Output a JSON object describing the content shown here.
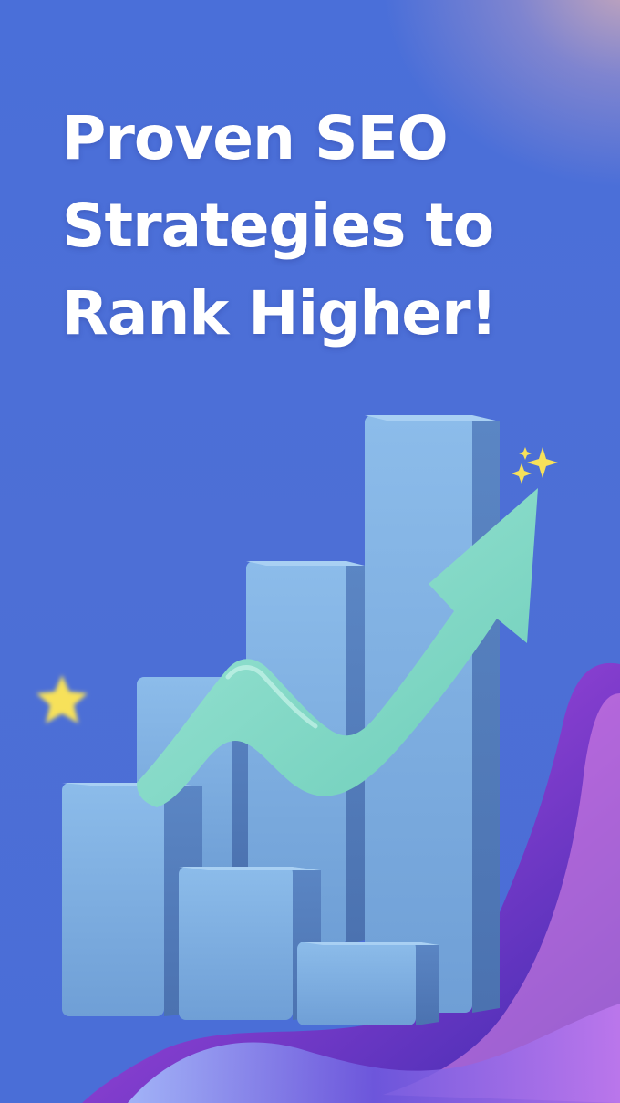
{
  "headline": {
    "line1": "Proven SEO",
    "line2": "Strategies to",
    "line3": "Rank Higher!"
  },
  "colors": {
    "background": "#4a6fd8",
    "headline_text": "#ffffff",
    "bars": "#7fb1e3",
    "arrow": "#86d9c8",
    "sparkle": "#f7e15a",
    "ribbon": "#b04fd6"
  },
  "icons": {
    "chart": "bar-chart-icon",
    "trend": "trend-up-arrow-icon",
    "sparkles": "sparkles-icon",
    "star": "star-icon"
  }
}
